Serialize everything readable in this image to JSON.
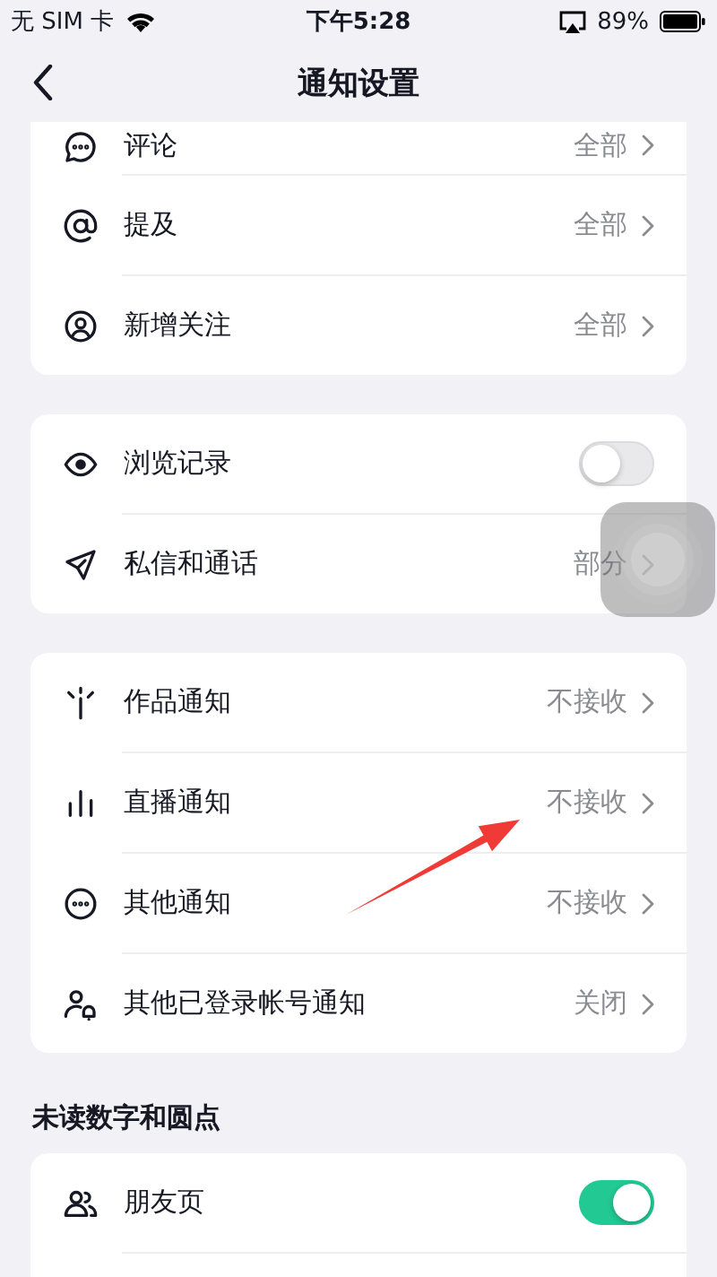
{
  "status_bar": {
    "carrier": "无 SIM 卡",
    "time": "下午5:28",
    "battery": "89%"
  },
  "nav": {
    "title": "通知设置"
  },
  "sections": [
    {
      "rows": [
        {
          "kind": "value",
          "label": "评论",
          "value": "全部"
        },
        {
          "kind": "value",
          "label": "提及",
          "value": "全部"
        },
        {
          "kind": "value",
          "label": "新增关注",
          "value": "全部"
        }
      ]
    },
    {
      "rows": [
        {
          "kind": "toggle",
          "label": "浏览记录",
          "on": false
        },
        {
          "kind": "value",
          "label": "私信和通话",
          "value": "部分"
        }
      ]
    },
    {
      "rows": [
        {
          "kind": "value",
          "label": "作品通知",
          "value": "不接收"
        },
        {
          "kind": "value",
          "label": "直播通知",
          "value": "不接收"
        },
        {
          "kind": "value",
          "label": "其他通知",
          "value": "不接收"
        },
        {
          "kind": "value",
          "label": "其他已登录帐号通知",
          "value": "关闭"
        }
      ]
    },
    {
      "heading": "未读数字和圆点",
      "rows": [
        {
          "kind": "toggle",
          "label": "朋友页",
          "on": true
        }
      ]
    }
  ]
}
